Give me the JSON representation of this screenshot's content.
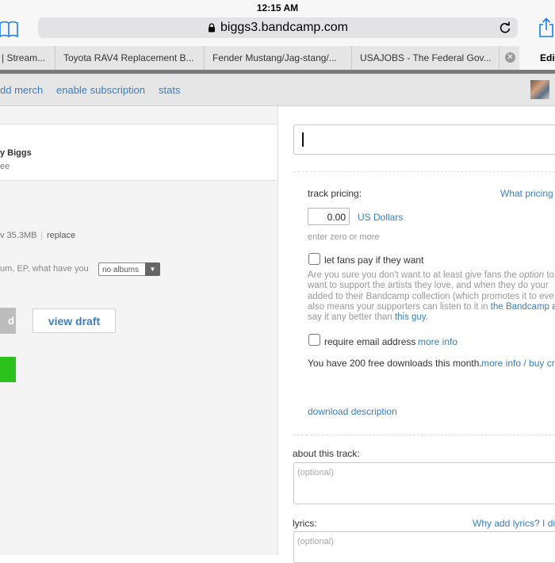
{
  "status": {
    "time": "12:15 AM"
  },
  "browser": {
    "url": "biggs3.bandcamp.com",
    "tabs": [
      {
        "label": "| Stream..."
      },
      {
        "label": "Toyota RAV4 Replacement B..."
      },
      {
        "label": "Fender Mustang/Jag-stang/..."
      },
      {
        "label": "USAJOBS - The Federal Gov..."
      }
    ],
    "active_tab": "Edit"
  },
  "nav": {
    "links": [
      "dd merch",
      "enable subscription",
      "stats"
    ]
  },
  "left": {
    "artist_line": "y Biggs",
    "artist_sub": "ee",
    "file_info": "v  35.3MB",
    "replace_label": "replace",
    "album_prompt": "um, EP, what have you",
    "album_select": "no albums",
    "grey_button": "d",
    "view_draft": "view draft"
  },
  "right": {
    "track_pricing_label": "track pricing:",
    "what_pricing": "What pricing",
    "price_value": "0.00",
    "currency": "US Dollars",
    "enter_zero": "enter zero or more",
    "let_fans_pay": "let fans pay if they want",
    "para_line1_a": "Are you sure you don't want to at least give fans the ",
    "para_line1_b": "option",
    "para_line1_c": " to",
    "para_line2": "want to support the artists they love, and when they do your",
    "para_line3": "added to their Bandcamp collection (which promotes it to eve",
    "para_line4_a": "also means your supporters can listen to it in ",
    "para_line4_b": "the Bandcamp a",
    "para_line5_a": "say it any better than ",
    "para_line5_b": "this guy",
    "para_line5_c": ".",
    "require_email": "require email address",
    "more_info": "more info",
    "free_downloads": "You have 200 free downloads this month.",
    "more_info_buy": "more info / buy cre",
    "download_description": "download description",
    "about_label": "about this track:",
    "about_placeholder": "(optional)",
    "lyrics_label": "lyrics:",
    "why_lyrics": "Why add lyrics? I dis",
    "lyrics_placeholder": "(optional)"
  },
  "colors": {
    "link": "#3a7ec1",
    "green": "#2cc21e"
  }
}
